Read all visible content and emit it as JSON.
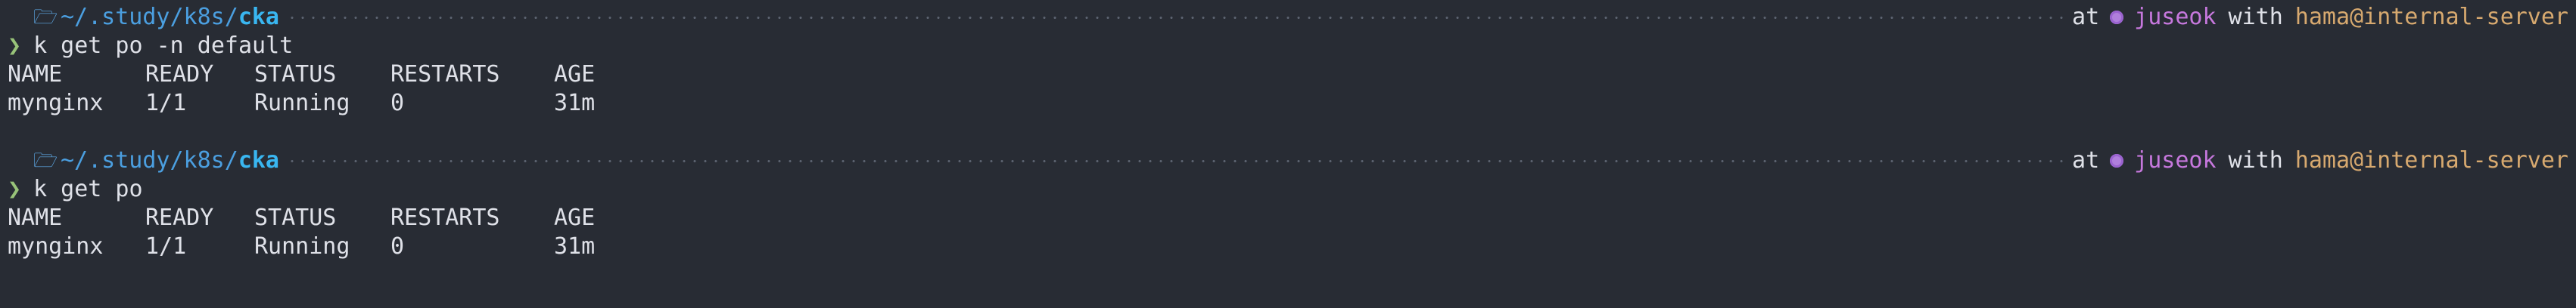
{
  "blocks": [
    {
      "prompt": {
        "os_icon": "apple-icon",
        "os_glyph": "",
        "folder_glyph": "🗁",
        "path_prefix": "~/.study/k8s/",
        "path_current": "cka",
        "at_label": "at",
        "context": "juseok",
        "with_label": "with",
        "user_host": "hama@internal-server"
      },
      "chevron": "❯",
      "command": "k get po -n default",
      "headers": [
        "NAME",
        "READY",
        "STATUS",
        "RESTARTS",
        "AGE"
      ],
      "rows": [
        [
          "mynginx",
          "1/1",
          "Running",
          "0",
          "31m"
        ]
      ]
    },
    {
      "prompt": {
        "os_icon": "apple-icon",
        "os_glyph": "",
        "folder_glyph": "🗁",
        "path_prefix": "~/.study/k8s/",
        "path_current": "cka",
        "at_label": "at",
        "context": "juseok",
        "with_label": "with",
        "user_host": "hama@internal-server"
      },
      "chevron": "❯",
      "command": "k get po",
      "headers": [
        "NAME",
        "READY",
        "STATUS",
        "RESTARTS",
        "AGE"
      ],
      "rows": [
        [
          "mynginx",
          "1/1",
          "Running",
          "0",
          "31m"
        ]
      ]
    }
  ],
  "colors": {
    "background": "#282c34",
    "path": "#39b6f0",
    "context": "#c678dd",
    "user_host": "#d7a96f",
    "chevron": "#98c379"
  }
}
